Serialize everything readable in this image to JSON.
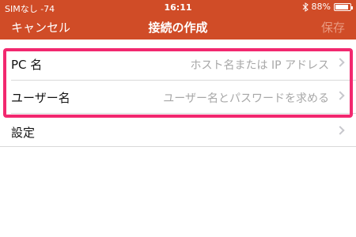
{
  "status_bar": {
    "carrier": "SIMなし -74",
    "time": "16:11",
    "battery": "88%",
    "battery_level": 0.88
  },
  "nav": {
    "cancel_label": "キャンセル",
    "title": "接続の作成",
    "save_label": "保存"
  },
  "rows": [
    {
      "label": "PC 名",
      "placeholder": "ホスト名または IP アドレス"
    },
    {
      "label": "ユーザー名",
      "placeholder": "ユーザー名とパスワードを求める"
    }
  ],
  "settings": {
    "label": "設定"
  },
  "colors": {
    "header": "#d04c27",
    "highlight": "#f2286f",
    "placeholder": "#a7a7a7"
  },
  "icons": [
    "bluetooth-icon",
    "battery-icon",
    "chevron-right-icon"
  ]
}
